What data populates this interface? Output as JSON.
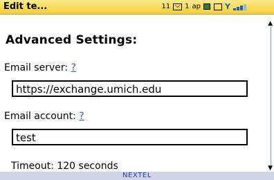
{
  "titlebar": {
    "title": "Edit te...",
    "message_count": "11",
    "signal_number": "1",
    "network_label": "ap"
  },
  "content": {
    "heading": "Advanced Settings:",
    "email_server_label": "Email server: ",
    "email_server_help": "?",
    "email_server_value": "https://exchange.umich.edu",
    "email_account_label": "Email account: ",
    "email_account_help": "?",
    "email_account_value": "test",
    "timeout_text": "Timeout: 120 seconds"
  },
  "footer": {
    "carrier": "NEXTEL"
  }
}
